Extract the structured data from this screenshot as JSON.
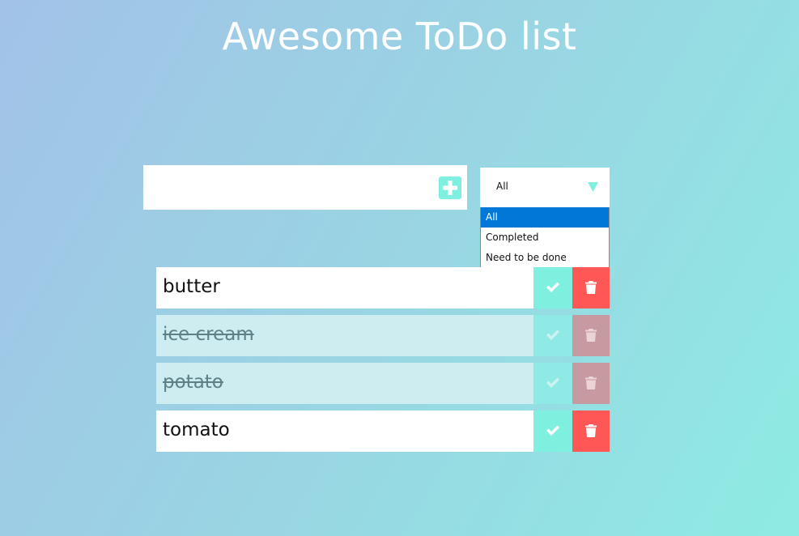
{
  "header": {
    "title": "Awesome ToDo list"
  },
  "new_todo": {
    "value": "",
    "placeholder": "",
    "add_icon": "plus-icon"
  },
  "filter": {
    "selected": "All",
    "options": [
      "All",
      "Completed",
      "Need to be done"
    ]
  },
  "todos": [
    {
      "text": "butter",
      "completed": false
    },
    {
      "text": "ice cream",
      "completed": true
    },
    {
      "text": "potato",
      "completed": true
    },
    {
      "text": "tomato",
      "completed": false
    }
  ],
  "colors": {
    "accent": "#7ff0e0",
    "delete": "#ff5656",
    "dropdown_highlight": "#0078d7"
  }
}
